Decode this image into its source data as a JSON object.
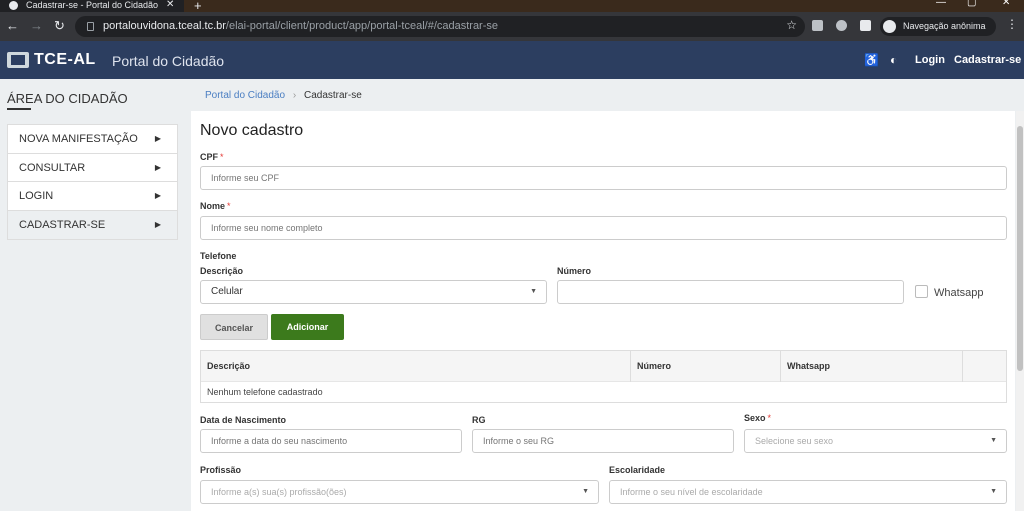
{
  "browser": {
    "tab_title": "Cadastrar-se - Portal do Cidadão",
    "url_host": "portalouvidona.tceal.tc.br",
    "url_path": "/elai-portal/client/product/app/portal-tceal/#/cadastrar-se",
    "incognito_label": "Navegação anônima"
  },
  "header": {
    "brand": "TCE-AL",
    "portal_title": "Portal do Cidadão",
    "login": "Login",
    "register": "Cadastrar-se"
  },
  "sidebar": {
    "title": "ÁREA DO CIDADÃO",
    "items": [
      {
        "label": "NOVA MANIFESTAÇÃO"
      },
      {
        "label": "CONSULTAR"
      },
      {
        "label": "LOGIN"
      },
      {
        "label": "CADASTRAR-SE"
      }
    ]
  },
  "breadcrumb": {
    "home": "Portal do Cidadão",
    "current": "Cadastrar-se"
  },
  "form": {
    "title": "Novo cadastro",
    "cpf": {
      "label": "CPF",
      "placeholder": "Informe seu CPF"
    },
    "nome": {
      "label": "Nome",
      "placeholder": "Informe seu nome completo"
    },
    "telefone": {
      "section_label": "Telefone",
      "descricao_label": "Descrição",
      "descricao_value": "Celular",
      "numero_label": "Número",
      "whatsapp_label": "Whatsapp",
      "cancel": "Cancelar",
      "add": "Adicionar"
    },
    "table": {
      "headers": [
        "Descrição",
        "Número",
        "Whatsapp"
      ],
      "empty": "Nenhum telefone cadastrado"
    },
    "nascimento": {
      "label": "Data de Nascimento",
      "placeholder": "Informe a data do seu nascimento"
    },
    "rg": {
      "label": "RG",
      "placeholder": "Informe o seu RG"
    },
    "sexo": {
      "label": "Sexo",
      "placeholder": "Selecione seu sexo"
    },
    "profissao": {
      "label": "Profissão",
      "placeholder": "Informe a(s) sua(s) profissão(ões)"
    },
    "escolaridade": {
      "label": "Escolaridade",
      "placeholder": "Informe o seu nível de escolaridade"
    }
  }
}
